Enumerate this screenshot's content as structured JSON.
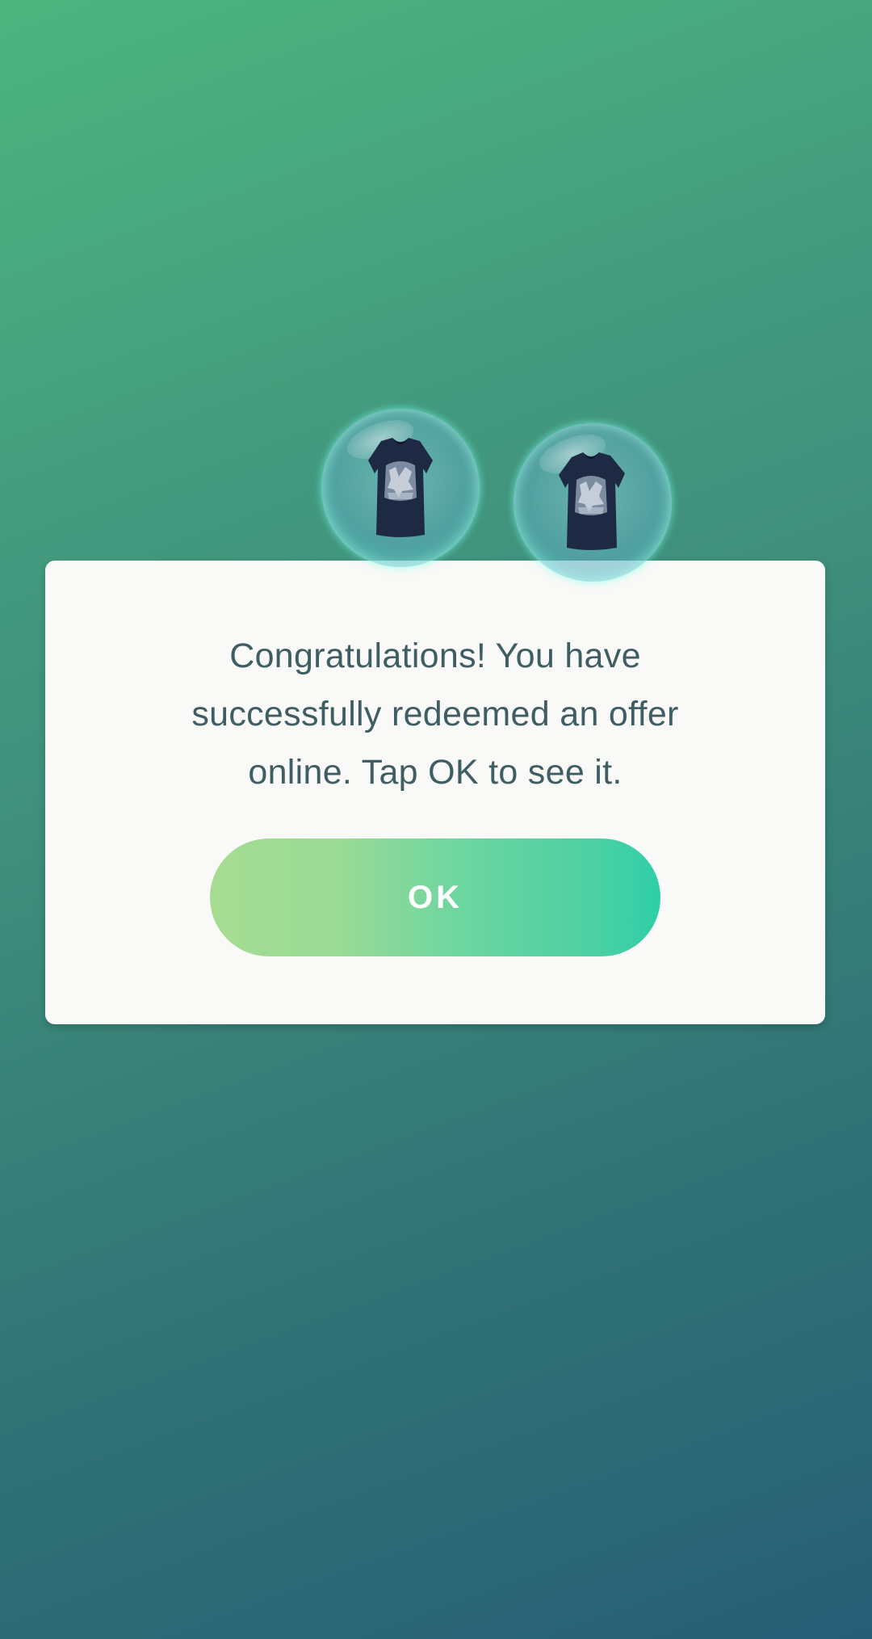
{
  "dialog": {
    "message": "Congratulations! You have successfully redeemed an offer online. Tap OK to see it.",
    "ok_label": "OK"
  },
  "rewards": [
    {
      "icon": "t-shirt-icon"
    },
    {
      "icon": "t-shirt-icon"
    }
  ],
  "colors": {
    "background_top": "#4cb57f",
    "background_bottom": "#275e77",
    "dialog_background": "#f9f9f7",
    "message_text": "#3f5e63",
    "button_gradient_start": "#a6dc92",
    "button_gradient_end": "#2ecfa8",
    "bubble_glow": "#78ffeb"
  }
}
